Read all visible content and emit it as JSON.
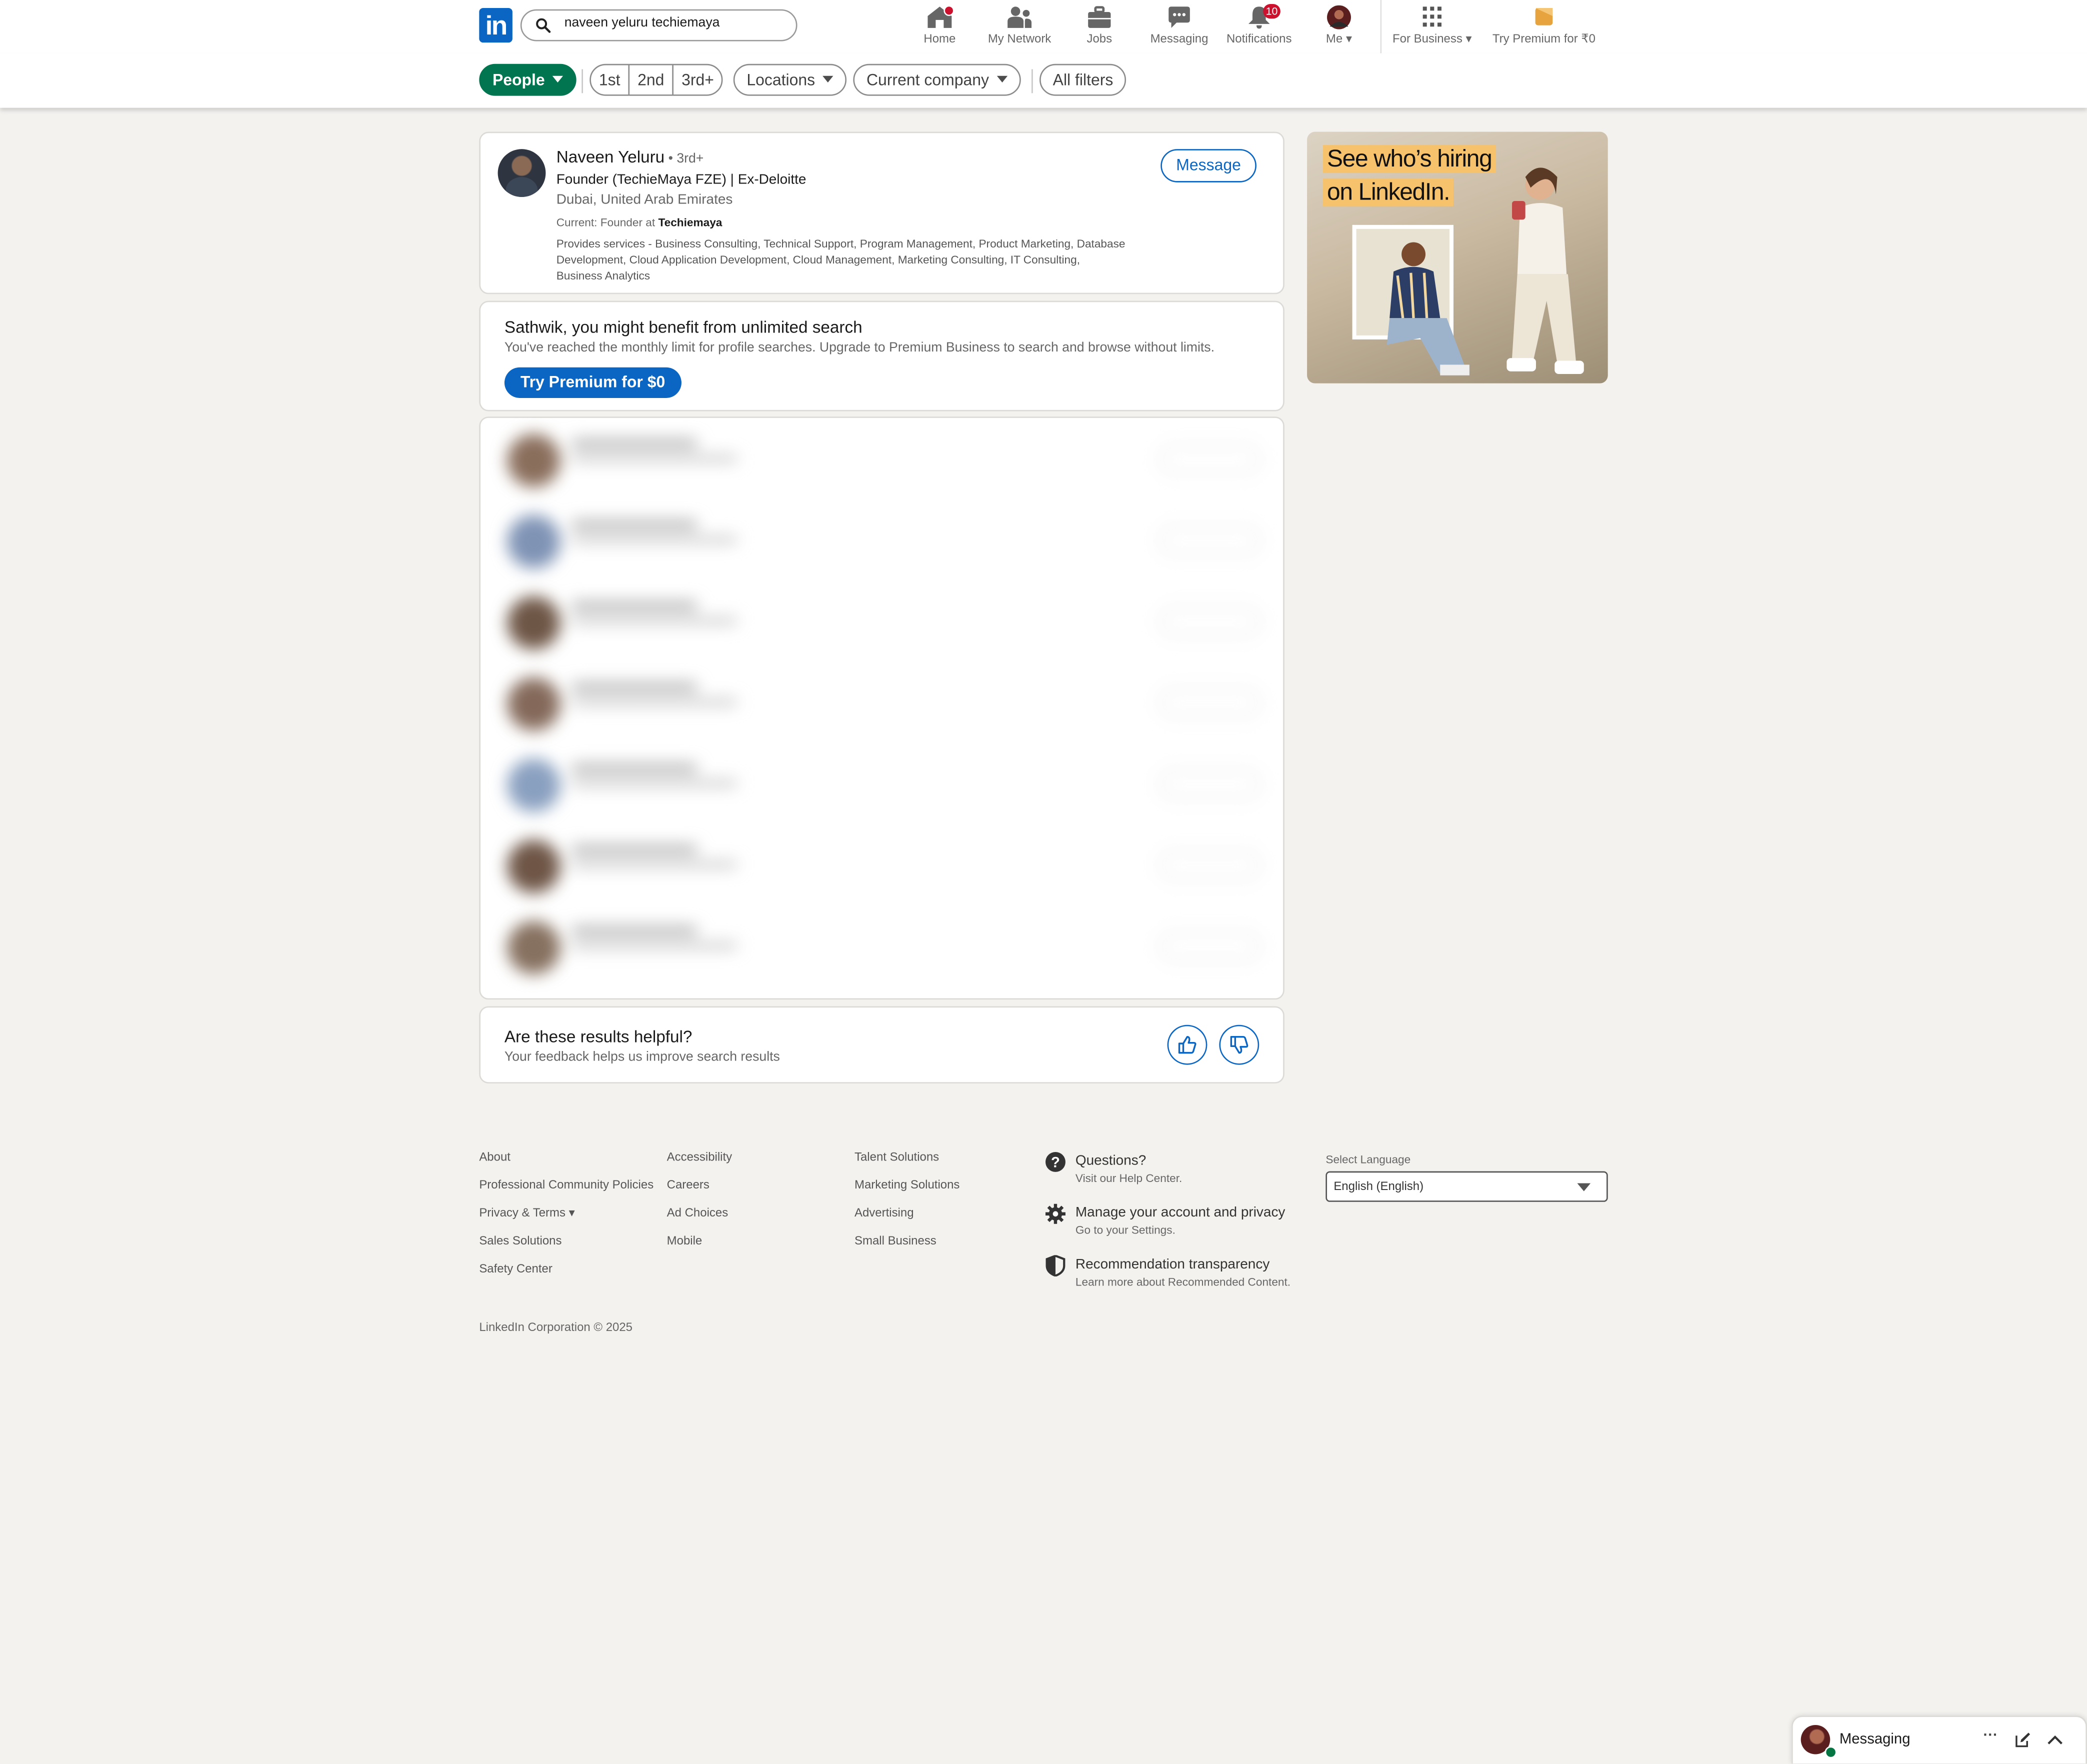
{
  "nav": {
    "logo": "in",
    "search_value": "naveen yeluru techiemaya",
    "home": "Home",
    "network": "My Network",
    "jobs": "Jobs",
    "messaging": "Messaging",
    "notifications": "Notifications",
    "notifications_count": "10",
    "me": "Me",
    "for_business": "For Business",
    "try_premium": "Try Premium for ₹0"
  },
  "filters": {
    "people": "People",
    "first": "1st",
    "second": "2nd",
    "third": "3rd+",
    "locations": "Locations",
    "current_company": "Current company",
    "all_filters": "All filters"
  },
  "result": {
    "name": "Naveen Yeluru",
    "degree": " • 3rd+",
    "headline": "Founder (TechieMaya FZE) | Ex-Deloitte",
    "location": "Dubai, United Arab Emirates",
    "current_prefix": "Current: Founder at ",
    "current_company": "Techiemaya",
    "services": "Provides services - Business Consulting, Technical Support, Program Management, Product Marketing, Database Development, Cloud Application Development, Cloud Management, Marketing Consulting, IT Consulting, Business Analytics",
    "message_button": "Message"
  },
  "premium": {
    "title": "Sathwik, you might benefit from unlimited search",
    "subtitle": "You've reached the monthly limit for profile searches. Upgrade to Premium Business to search and browse without limits.",
    "button": "Try Premium for $0"
  },
  "feedback": {
    "title": "Are these results helpful?",
    "subtitle": "Your feedback helps us improve search results"
  },
  "ad": {
    "line1": "See who’s hiring",
    "line2": "on LinkedIn."
  },
  "footer": {
    "col1": [
      "About",
      "Professional Community Policies",
      "Privacy & Terms",
      "Sales Solutions",
      "Safety Center"
    ],
    "col2": [
      "Accessibility",
      "Careers",
      "Ad Choices",
      "Mobile"
    ],
    "col3": [
      "Talent Solutions",
      "Marketing Solutions",
      "Advertising",
      "Small Business"
    ],
    "help": [
      {
        "title": "Questions?",
        "sub": "Visit our Help Center."
      },
      {
        "title": "Manage your account and privacy",
        "sub": "Go to your Settings."
      },
      {
        "title": "Recommendation transparency",
        "sub": "Learn more about Recommended Content."
      }
    ],
    "language_label": "Select Language",
    "language_value": "English (English)",
    "copyright": "LinkedIn Corporation © 2025"
  },
  "messaging_bar": {
    "title": "Messaging",
    "more": "···"
  },
  "colors": {
    "brand": "#0a66c2",
    "people_pill": "#01754f",
    "badge": "#cb112d",
    "ad_highlight": "#f6c26b"
  }
}
